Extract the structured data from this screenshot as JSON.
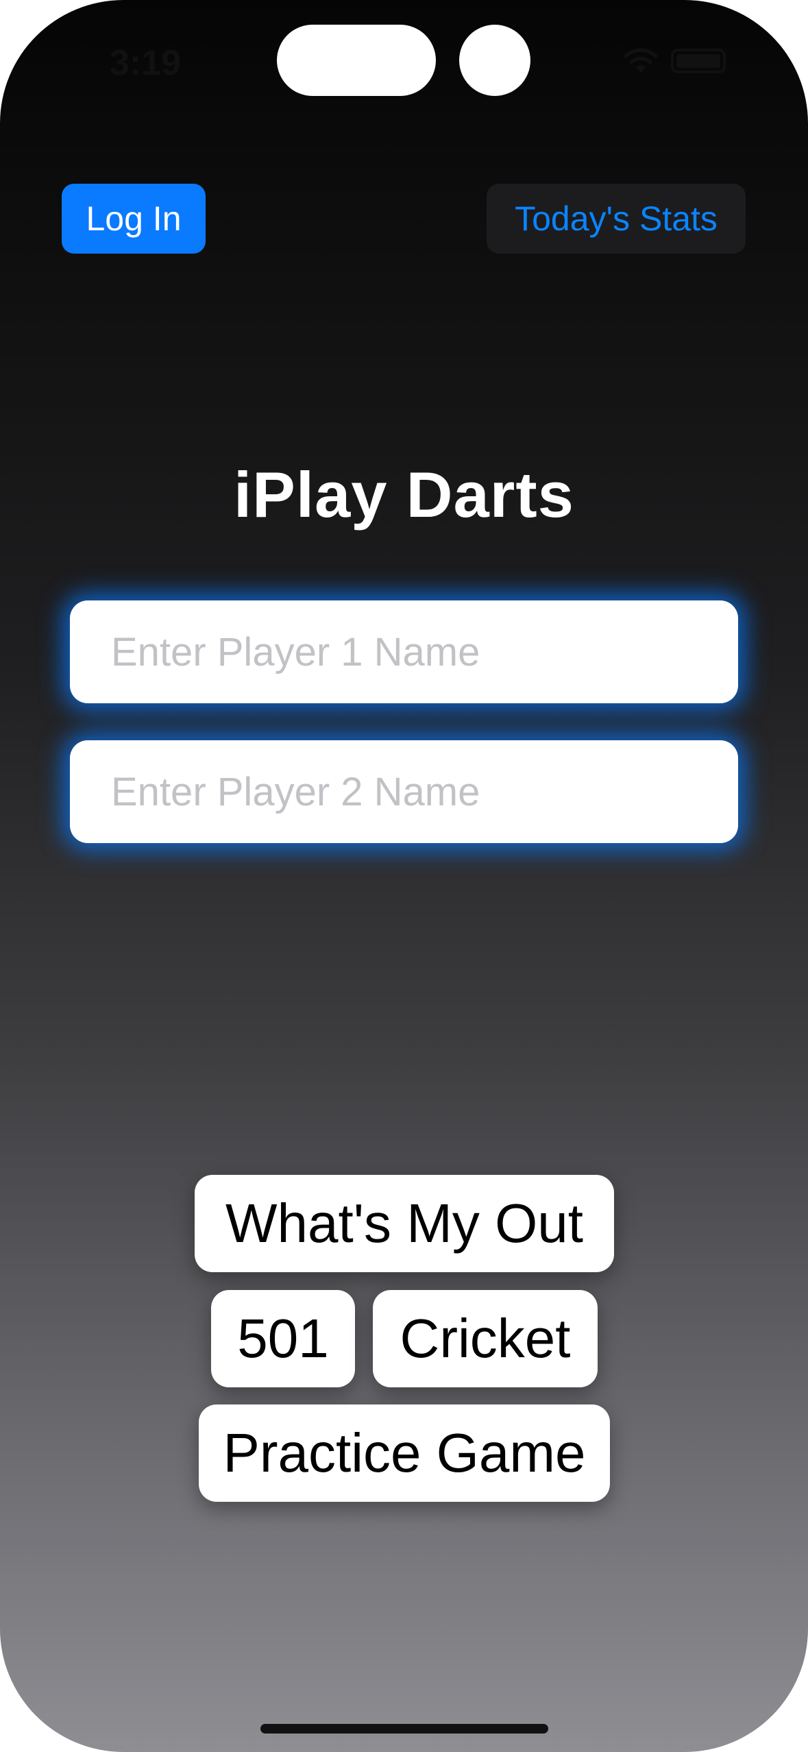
{
  "status_bar": {
    "time": "3:19",
    "wifi_icon": "wifi-icon",
    "battery_icon": "battery-icon"
  },
  "header": {
    "login_label": "Log In",
    "stats_label": "Today's Stats"
  },
  "app": {
    "title": "iPlay Darts"
  },
  "inputs": {
    "player1": {
      "value": "",
      "placeholder": "Enter Player 1 Name"
    },
    "player2": {
      "value": "",
      "placeholder": "Enter Player 2 Name"
    }
  },
  "games": {
    "whats_my_out": "What's My Out",
    "five_oh_one": "501",
    "cricket": "Cricket",
    "practice": "Practice Game"
  },
  "colors": {
    "accent": "#0a7aff",
    "stats_button_bg": "#1c1c1e",
    "input_glow": "#0a7aff",
    "placeholder": "#c2c2c6"
  }
}
